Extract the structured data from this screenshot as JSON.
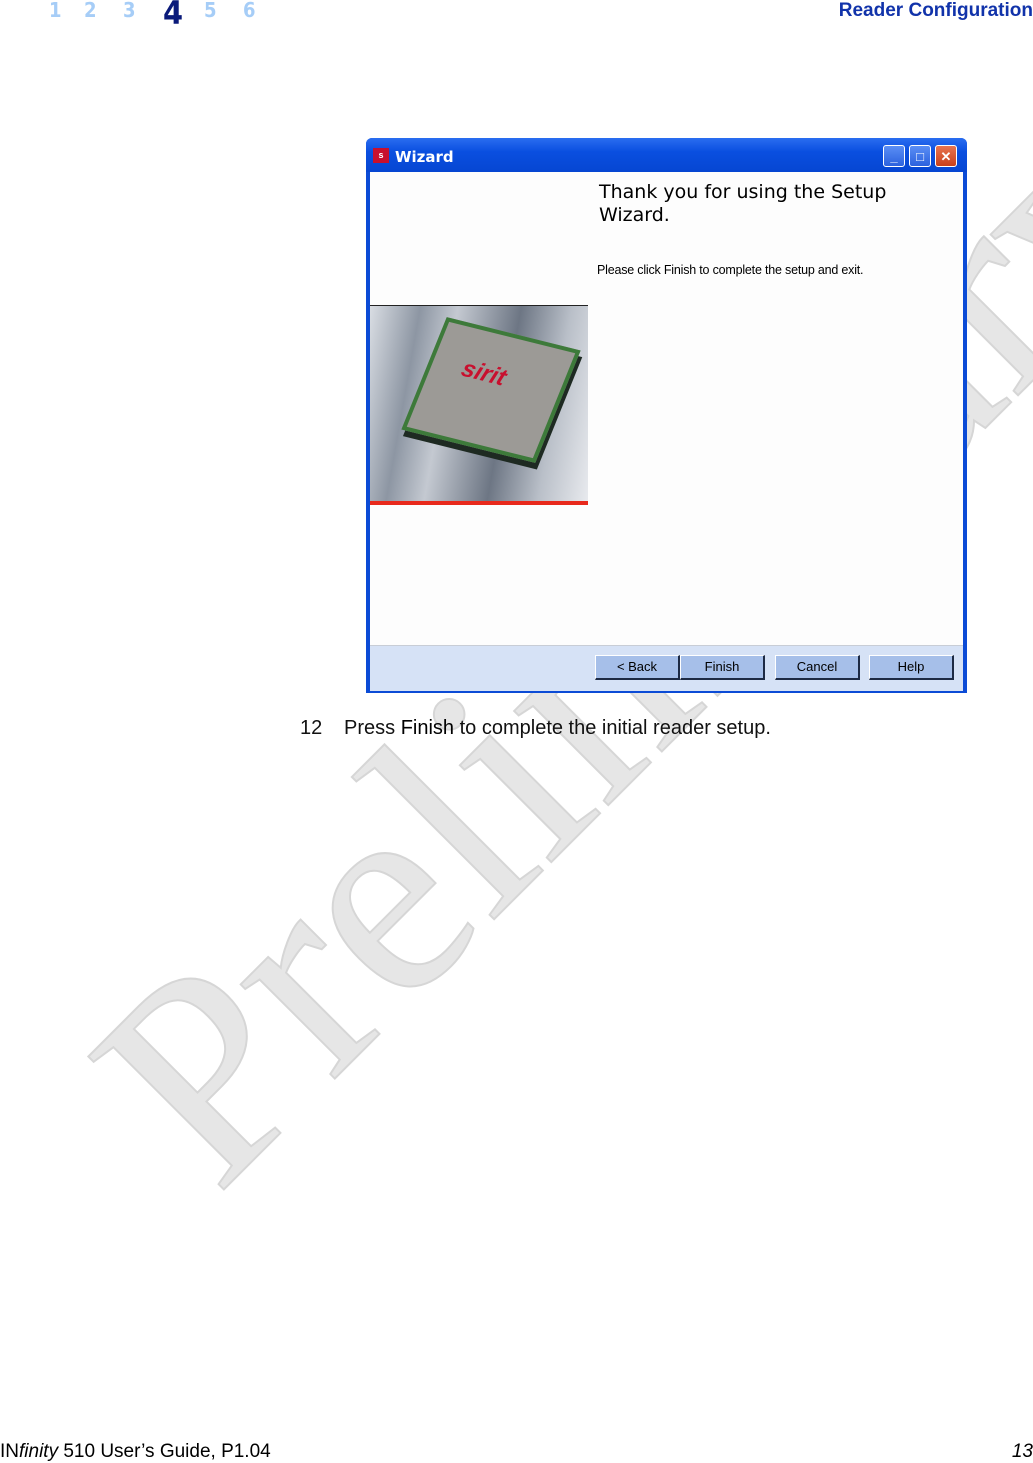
{
  "header": {
    "chapters": [
      "1",
      "2",
      "3",
      "4",
      "5",
      "6"
    ],
    "current_chapter": "4",
    "section_title": "Reader Configuration"
  },
  "wizard": {
    "title": "Wizard",
    "app_icon_text": "sirit",
    "heading": "Thank you for using the Setup Wizard.",
    "message": "Please click Finish to complete the setup and exit.",
    "image_logo": "RFID sirit",
    "buttons": {
      "back": "< Back",
      "finish": "Finish",
      "cancel": "Cancel",
      "help": "Help"
    },
    "controls": {
      "minimize": "_",
      "maximize": "□",
      "close": "✕"
    }
  },
  "caption": {
    "number": "12",
    "pre": "Press ",
    "bold": "Finish",
    "post": " to complete the initial reader setup."
  },
  "watermark": "Preliminary",
  "footer": {
    "brand_prefix": "IN",
    "brand_italic": "finity",
    "title_rest": " 510 User’s Guide, P1.04",
    "page": "13"
  },
  "colors": {
    "titlebar": "#0a4fe0",
    "chapter_current": "#0a1a7a",
    "chapter_other": "#a6cdf7",
    "header_title": "#1133aa"
  }
}
